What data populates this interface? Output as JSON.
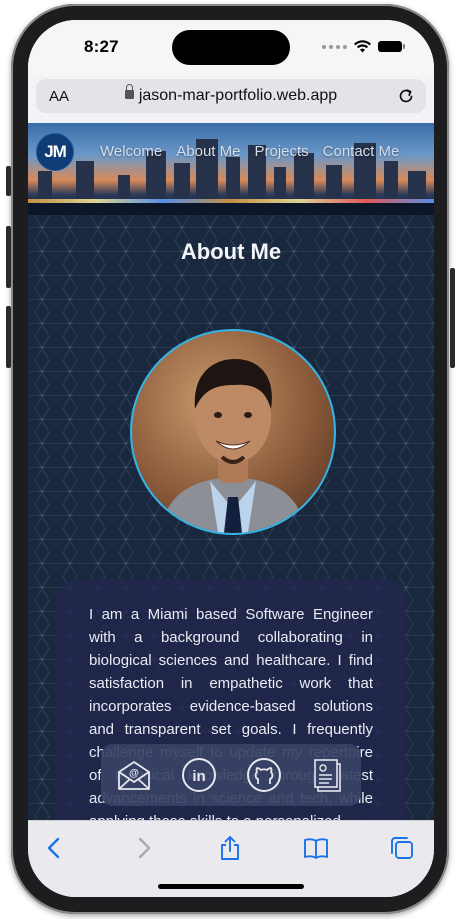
{
  "status_bar": {
    "time": "8:27"
  },
  "browser": {
    "aa_label": "AA",
    "url": "jason-mar-portfolio.web.app"
  },
  "site": {
    "logo_text": "JM",
    "nav": [
      "Welcome",
      "About Me",
      "Projects",
      "Contact Me"
    ],
    "page_title": "About Me",
    "about_text": "I am a Miami based Software Engineer with a background collaborating in biological sciences and healthcare. I find satisfaction in empathetic work that incorporates evidence-based solutions and transparent set goals. I frequently challenge myself to update my repertoire of technical knowledge through latest advancements in science and tech, while applying these skills to a personalized",
    "social_icons": [
      "email-icon",
      "linkedin-icon",
      "github-icon",
      "resume-icon"
    ]
  },
  "toolbar_icons": [
    "back-icon",
    "forward-icon",
    "share-icon",
    "bookmarks-icon",
    "tabs-icon"
  ],
  "colors": {
    "accent": "#33b3e6",
    "background": "#19283d",
    "card": "#22264e"
  }
}
